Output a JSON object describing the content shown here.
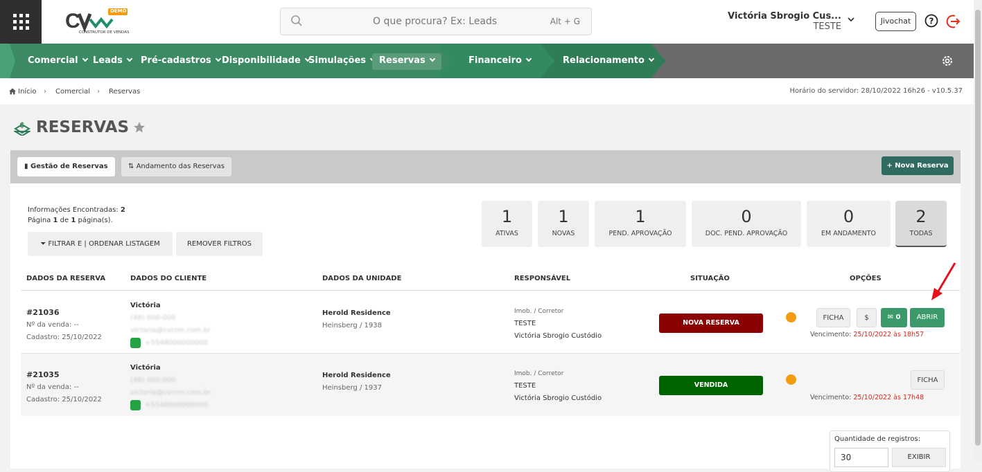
{
  "app": {
    "logo_text": "CV",
    "logo_badge": "DEMO",
    "logo_sub": "CONSTRUTOR DE VENDAS"
  },
  "search": {
    "placeholder": "O que procura? Ex: Leads",
    "shortcut": "Alt + G",
    "icon": "search-icon"
  },
  "user": {
    "name": "Victória Sbrogio Cus...",
    "role": "TESTE",
    "jivochat": "Jivochat"
  },
  "nav": {
    "items": [
      "Comercial",
      "Leads",
      "Pré-cadastros",
      "Disponibilidade",
      "Simulações",
      "Reservas",
      "Financeiro",
      "Relacionamento"
    ],
    "active": "Reservas",
    "colors": {
      "green": "#3b8a64",
      "dark_green": "#2f7d57",
      "gray": "#6b6b6b"
    }
  },
  "breadcrumb": {
    "home": "Início",
    "level1": "Comercial",
    "level2": "Reservas",
    "server": "Horário do servidor: 28/10/2022 16h26 - v10.5.37"
  },
  "page": {
    "title": "RESERVAS"
  },
  "tabs": {
    "gestao": "Gestão de Reservas",
    "andamento": "Andamento das Reservas",
    "new_button": "Nova Reserva"
  },
  "info": {
    "found_label": "Informações Encontradas:",
    "found": "2",
    "page_prefix": "Página",
    "page": "1",
    "page_mid": "de",
    "pages": "1",
    "page_suffix": "página(s)."
  },
  "filters": {
    "filter": "FILTRAR E | ORDENAR LISTAGEM",
    "remove": "REMOVER FILTROS"
  },
  "cards": [
    {
      "value": "1",
      "label": "ATIVAS"
    },
    {
      "value": "1",
      "label": "NOVAS"
    },
    {
      "value": "1",
      "label": "PEND. APROVAÇÃO"
    },
    {
      "value": "0",
      "label": "DOC. PEND. APROVAÇÃO"
    },
    {
      "value": "0",
      "label": "EM ANDAMENTO"
    },
    {
      "value": "2",
      "label": "TODAS"
    }
  ],
  "columns": {
    "reserva": "DADOS DA RESERVA",
    "cliente": "DADOS DO CLIENTE",
    "unidade": "DADOS DA UNIDADE",
    "responsavel": "RESPONSÁVEL",
    "situacao": "SITUAÇÃO",
    "opcoes": "OPÇÕES"
  },
  "rows": [
    {
      "id": "#21036",
      "venda": "Nº da venda: --",
      "cadastro": "Cadastro: 25/10/2022",
      "client": "Victória",
      "phone": "(48) 000-000",
      "email": "victoria@cvcrm.com.br",
      "whatsapp": "+5548000000000",
      "unit": "Herold Residence",
      "unit_sub": "Heinsberg / 1938",
      "resp_label": "Imob. / Corretor",
      "resp_imob": "TESTE",
      "resp_name": "Victória Sbrogio Custódio",
      "status": "NOVA RESERVA",
      "status_color": "#8b0000",
      "venc_label": "Vencimento:",
      "venc": "25/10/2022 às 18h57",
      "btn_ficha": "FICHA",
      "btn_money": "$",
      "btn_chat": "0",
      "btn_open": "ABRIR"
    },
    {
      "id": "#21035",
      "venda": "Nº da venda: --",
      "cadastro": "Cadastro: 25/10/2022",
      "client": "Victória",
      "phone": "(48) 000-000",
      "email": "victoria@cvcrm.com.br",
      "whatsapp": "+5548000000000",
      "unit": "Herold Residence",
      "unit_sub": "Heinsberg / 1937",
      "resp_label": "Imob. / Corretor",
      "resp_imob": "TESTE",
      "resp_name": "Victória Sbrogio Custódio",
      "status": "VENDIDA",
      "status_color": "#006400",
      "venc_label": "Vencimento:",
      "venc": "25/10/2022 às 17h48",
      "btn_ficha": "FICHA"
    }
  ],
  "quantity": {
    "label": "Quantidade de registros:",
    "value": "30",
    "button": "EXIBIR"
  }
}
